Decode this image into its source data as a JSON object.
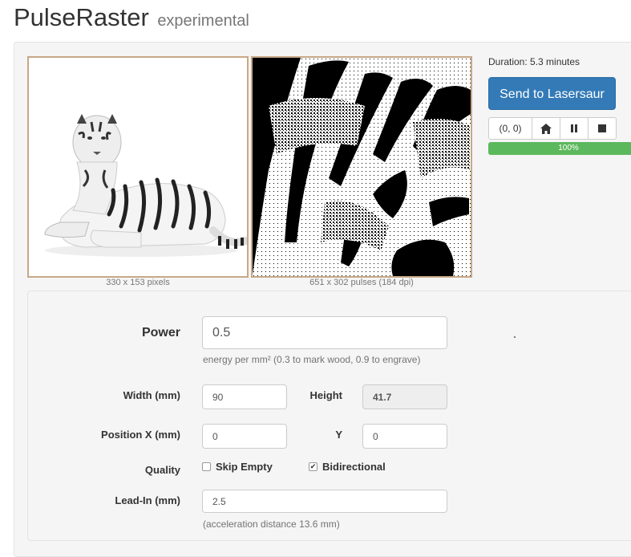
{
  "header": {
    "title": "PulseRaster",
    "subtitle": "experimental"
  },
  "images": {
    "original_caption": "330 x 153 pixels",
    "raster_caption": "651 x 302 pulses (184 dpi)"
  },
  "job": {
    "duration": "Duration: 5.3 minutes",
    "send_label": "Send to Lasersaur",
    "coords": "(0, 0)",
    "controls": [
      "home-icon",
      "pause-icon",
      "stop-icon"
    ],
    "progress_text": "100%",
    "progress": 1.0
  },
  "form": {
    "power": {
      "label": "Power",
      "value": "0.5",
      "help": "energy per mm² (0.3 to mark wood, 0.9 to engrave)"
    },
    "width": {
      "label": "Width (mm)",
      "value": "90"
    },
    "height": {
      "label": "Height",
      "value": "41.7"
    },
    "position_x": {
      "label": "Position X (mm)",
      "value": "0"
    },
    "position_y": {
      "label": "Y",
      "value": "0"
    },
    "quality": {
      "label": "Quality",
      "skip_empty": {
        "label": "Skip Empty",
        "checked": false
      },
      "bidirectional": {
        "label": "Bidirectional",
        "checked": true
      }
    },
    "lead_in": {
      "label": "Lead-In (mm)",
      "value": "2.5",
      "help": "(acceleration distance 13.6 mm)"
    }
  },
  "colors": {
    "primary": "#337ab7",
    "success": "#5cb85c",
    "frame": "#c8a887"
  }
}
